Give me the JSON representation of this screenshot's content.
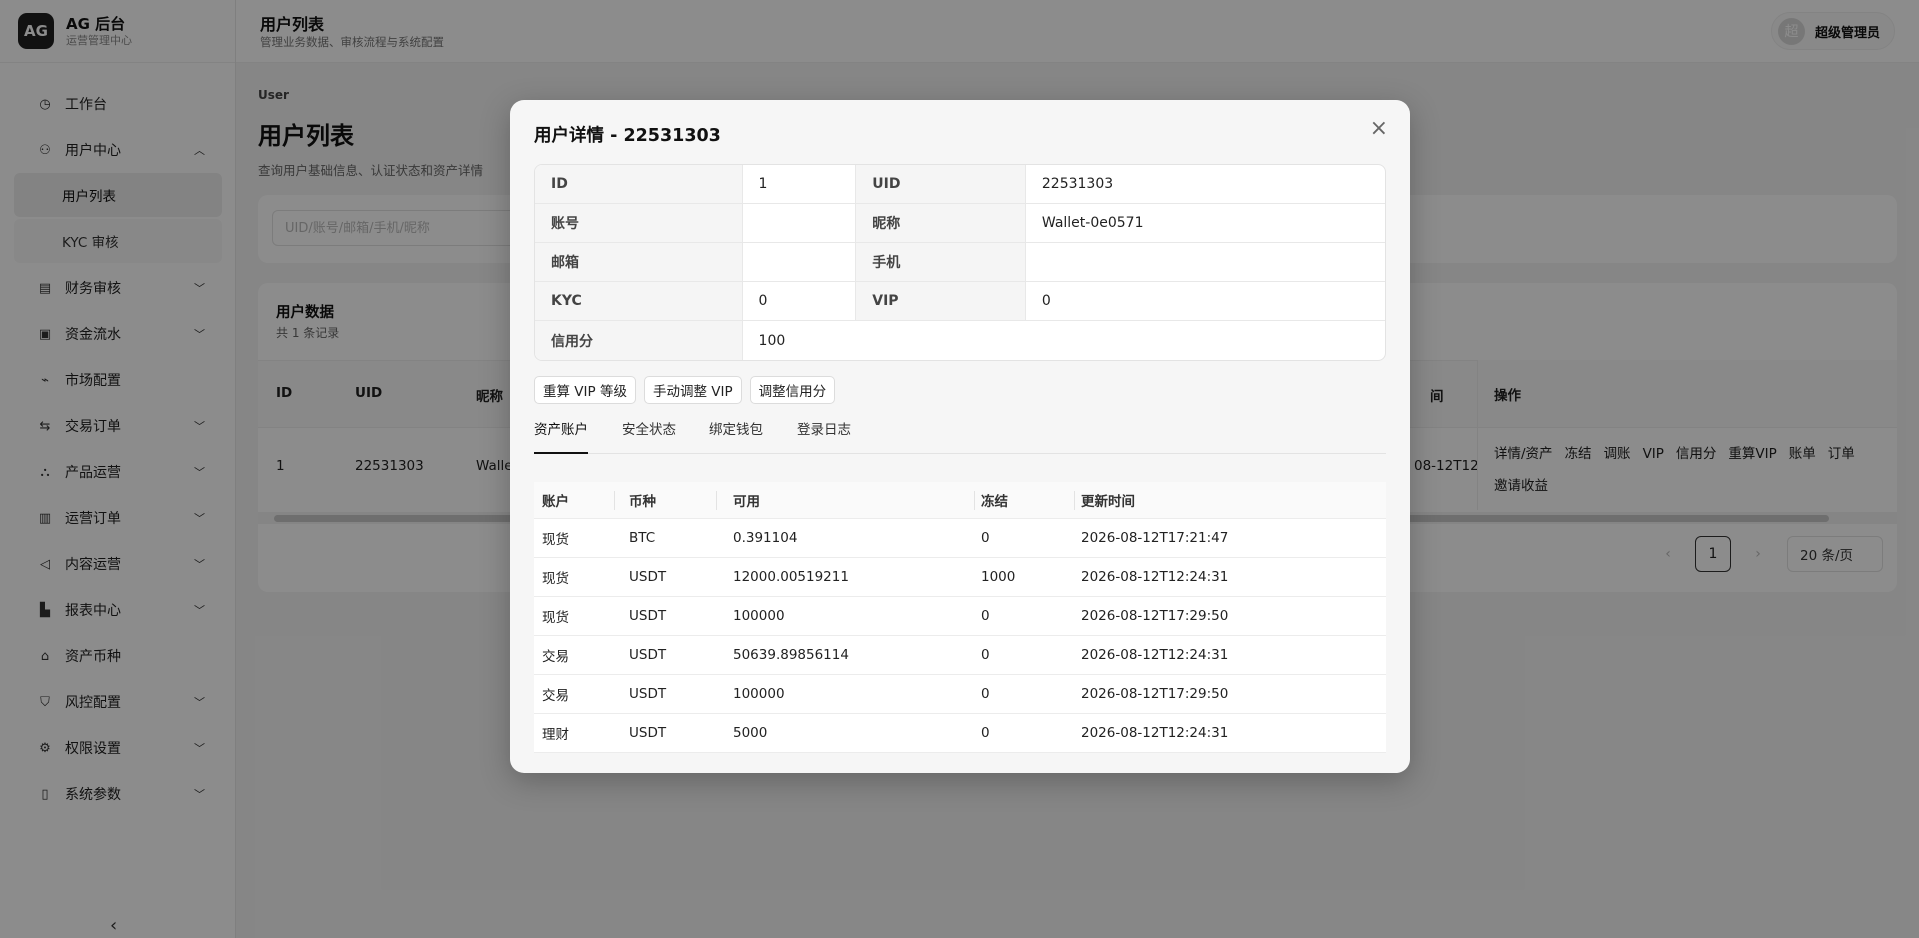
{
  "brand": {
    "logo": "AG",
    "title": "AG 后台",
    "subtitle": "运营管理中心"
  },
  "nav": {
    "items": [
      {
        "label": "工作台",
        "icon": "dashboard-icon"
      },
      {
        "label": "用户中心",
        "icon": "users-icon"
      },
      {
        "label": "财务审核",
        "icon": "finance-audit-icon"
      },
      {
        "label": "资金流水",
        "icon": "cashflow-icon"
      },
      {
        "label": "市场配置",
        "icon": "market-icon"
      },
      {
        "label": "交易订单",
        "icon": "trade-icon"
      },
      {
        "label": "产品运营",
        "icon": "product-icon"
      },
      {
        "label": "运营订单",
        "icon": "ops-order-icon"
      },
      {
        "label": "内容运营",
        "icon": "content-icon"
      },
      {
        "label": "报表中心",
        "icon": "report-icon"
      },
      {
        "label": "资产币种",
        "icon": "bank-icon"
      },
      {
        "label": "风控配置",
        "icon": "shield-icon"
      },
      {
        "label": "权限设置",
        "icon": "gear-icon"
      },
      {
        "label": "系统参数",
        "icon": "doc-icon"
      }
    ],
    "sub": {
      "user_list": "用户列表",
      "kyc": "KYC 审核"
    }
  },
  "header": {
    "title": "用户列表",
    "subtitle": "管理业务数据、审核流程与系统配置",
    "avatar": "超",
    "user": "超级管理员"
  },
  "page": {
    "crumb": "User",
    "title": "用户列表",
    "desc": "查询用户基础信息、认证状态和资产详情",
    "search_placeholder": "UID/账号/邮箱/手机/昵称",
    "card_title": "用户数据",
    "card_count": "共 1 条记录",
    "columns": {
      "id": "ID",
      "uid": "UID",
      "nick": "昵称",
      "time": "间",
      "ops": "操作"
    },
    "row": {
      "id": "1",
      "uid": "22531303",
      "nick": "Walle",
      "time": "08-12T12:2"
    },
    "ops": [
      "详情/资产",
      "冻结",
      "调账",
      "VIP",
      "信用分",
      "重算VIP",
      "账单",
      "订单",
      "邀请收益"
    ],
    "pager": {
      "prev": "‹",
      "page": "1",
      "next": "›",
      "size": "20 条/页"
    }
  },
  "modal": {
    "title": "用户详情 - 22531303",
    "close": "×",
    "info": {
      "id_label": "ID",
      "id": "1",
      "uid_label": "UID",
      "uid": "22531303",
      "account_label": "账号",
      "account": "",
      "nick_label": "昵称",
      "nick": "Wallet-0e0571",
      "email_label": "邮箱",
      "email": "",
      "phone_label": "手机",
      "phone": "",
      "kyc_label": "KYC",
      "kyc": "0",
      "vip_label": "VIP",
      "vip": "0",
      "credit_label": "信用分",
      "credit": "100"
    },
    "buttons": {
      "recalc_vip": "重算 VIP 等级",
      "manual_vip": "手动调整 VIP",
      "adjust_credit": "调整信用分"
    },
    "tabs": [
      "资产账户",
      "安全状态",
      "绑定钱包",
      "登录日志"
    ],
    "asset_columns": [
      "账户",
      "币种",
      "可用",
      "冻结",
      "更新时间"
    ],
    "assets": [
      [
        "现货",
        "BTC",
        "0.391104",
        "0",
        "2026-08-12T17:21:47"
      ],
      [
        "现货",
        "USDT",
        "12000.00519211",
        "1000",
        "2026-08-12T12:24:31"
      ],
      [
        "现货",
        "USDT",
        "100000",
        "0",
        "2026-08-12T17:29:50"
      ],
      [
        "交易",
        "USDT",
        "50639.89856114",
        "0",
        "2026-08-12T12:24:31"
      ],
      [
        "交易",
        "USDT",
        "100000",
        "0",
        "2026-08-12T17:29:50"
      ],
      [
        "理财",
        "USDT",
        "5000",
        "0",
        "2026-08-12T12:24:31"
      ]
    ]
  }
}
